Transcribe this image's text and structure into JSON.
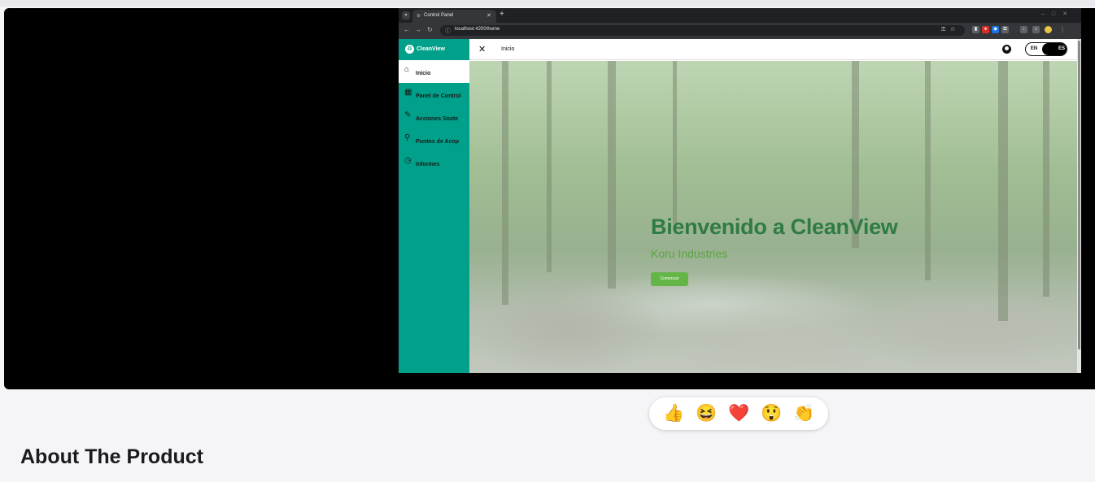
{
  "browser": {
    "tab_title": "Control Panel",
    "url": "localhost:4200/home"
  },
  "app": {
    "brand": "CleanView",
    "breadcrumb": "Inicio",
    "sidebar": {
      "items": [
        {
          "label": "Inicio",
          "icon": "home-icon",
          "active": true
        },
        {
          "label": "Panel de Control",
          "icon": "dashboard-icon",
          "active": false
        },
        {
          "label": "Acciones Soste",
          "icon": "edit-icon",
          "active": false
        },
        {
          "label": "Puntos de Acop",
          "icon": "location-icon",
          "active": false
        },
        {
          "label": "Informes",
          "icon": "clock-icon",
          "active": false
        }
      ]
    },
    "language": {
      "en": "EN",
      "es": "ES",
      "selected": "ES"
    },
    "hero": {
      "title": "Bienvenido a CleanView",
      "subtitle": "Koru Industries",
      "button_label": "Comenzar"
    }
  },
  "reactions": [
    {
      "emoji": "👍",
      "name": "thumbs-up"
    },
    {
      "emoji": "😆",
      "name": "laughing"
    },
    {
      "emoji": "❤️",
      "name": "heart"
    },
    {
      "emoji": "😲",
      "name": "astonished"
    },
    {
      "emoji": "👏",
      "name": "clapping"
    }
  ],
  "page": {
    "section_title": "About The Product"
  },
  "colors": {
    "sidebar": "#00a08a",
    "hero_title": "#2f7a47",
    "hero_subtitle": "#5aa540",
    "hero_button": "#63b545"
  }
}
